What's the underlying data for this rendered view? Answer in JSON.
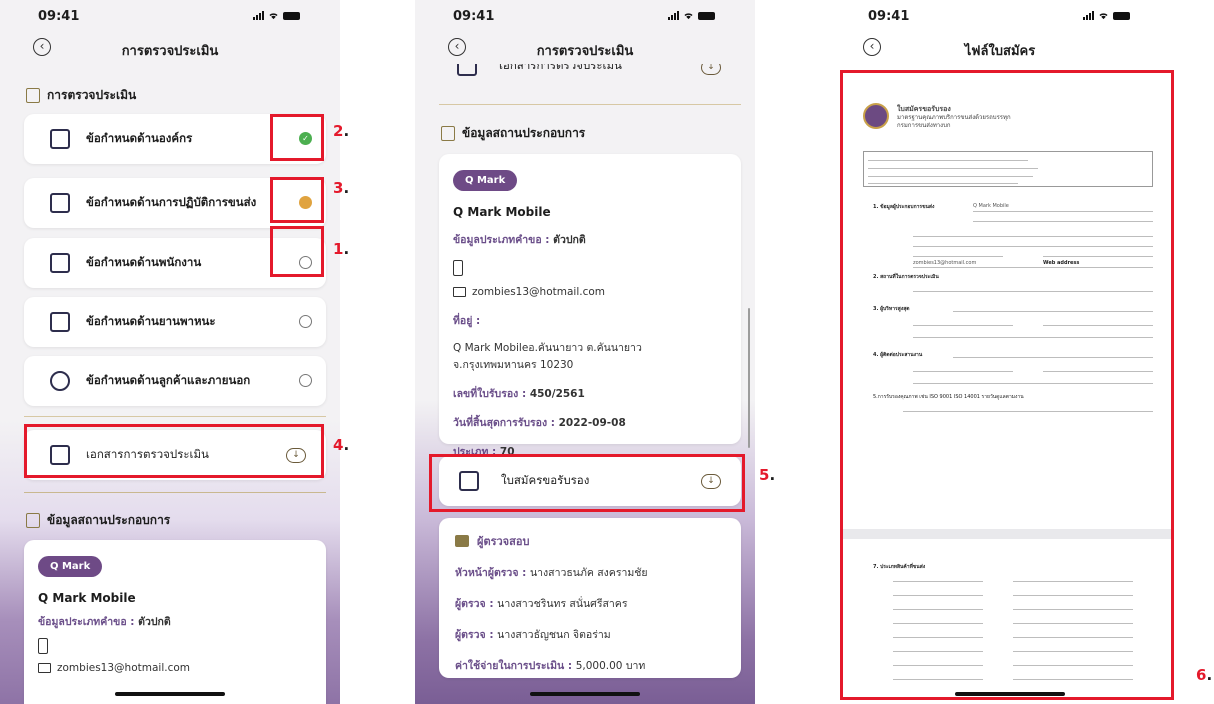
{
  "status": {
    "time": "09:41"
  },
  "screen1": {
    "nav_title": "การตรวจประเมิน",
    "section_title": "การตรวจประเมิน",
    "items": [
      {
        "label": "ข้อกำหนดด้านองค์กร",
        "status": "done",
        "icon": "building-icon"
      },
      {
        "label": "ข้อกำหนดด้านการปฏิบัติการขนส่ง",
        "status": "pending",
        "icon": "cube-icon"
      },
      {
        "label": "ข้อกำหนดด้านพนักงาน",
        "status": "empty",
        "icon": "document-edit-icon"
      },
      {
        "label": "ข้อกำหนดด้านยานพาหนะ",
        "status": "empty",
        "icon": "truck-icon"
      },
      {
        "label": "ข้อกำหนดด้านลูกค้าและภายนอก",
        "status": "empty",
        "icon": "user-circle-icon"
      }
    ],
    "doc_item": "เอกสารการตรวจประเมิน",
    "operator_section": "ข้อมูลสถานประกอบการ",
    "badge": "Q Mark",
    "company": "Q Mark Mobile",
    "type_label": "ข้อมูลประเภทคำขอ :",
    "type_value": "ตัวปกติ",
    "email": "zombies13@hotmail.com",
    "annotations": [
      "2",
      "3",
      "1",
      "4"
    ],
    "annotation_dot": "."
  },
  "screen2": {
    "nav_title": "การตรวจประเมิน",
    "partial_item": "เอกสารการตรวจประเมิน",
    "operator_section": "ข้อมูลสถานประกอบการ",
    "badge": "Q Mark",
    "company": "Q Mark Mobile",
    "type_label": "ข้อมูลประเภทคำขอ :",
    "type_value": "ตัวปกติ",
    "email": "zombies13@hotmail.com",
    "address_label": "ที่อยู่ :",
    "address_line1": "Q Mark Mobileอ.คันนายาว ต.คันนายาว",
    "address_line2": "จ.กรุงเทพมหานคร 10230",
    "cert_no_label": "เลขที่ใบรับรอง :",
    "cert_no": "450/2561",
    "expiry_label": "วันที่สิ้นสุดการรับรอง :",
    "expiry": "2022-09-08",
    "category_label": "ประเภท :",
    "category": "70",
    "application_item": "ใบสมัครขอรับรอง",
    "inspector_section": "ผู้ตรวจสอบ",
    "lead_label": "หัวหน้าผู้ตรวจ :",
    "lead": "นางสาวธนภัค สงครามชัย",
    "inspector1_label": "ผู้ตรวจ :",
    "inspector1": "นางสาวชรินทร สนั่นศรีสาคร",
    "inspector2_label": "ผู้ตรวจ :",
    "inspector2": "นางสาวธัญชนก จิตอร่าม",
    "cost_label": "ค่าใช้จ่ายในการประเมิน :",
    "cost": "5,000.00 บาท",
    "annotation": "5"
  },
  "screen3": {
    "nav_title": "ไฟล์ใบสมัคร",
    "doc_title": "ใบสมัครขอรับรอง",
    "doc_sub1": "มาตรฐานคุณภาพบริการขนส่งด้วยรถบรรทุก",
    "doc_sub2": "กรมการขนส่งทางบก",
    "doc_section1": "1. ข้อมูลผู้ประกอบการขนส่ง",
    "doc_name_hint": "Q Mark Mobile",
    "doc_email": "zombies13@hotmail.com",
    "doc_web": "Web address",
    "doc_section2": "2. สถานที่ในการตรวจประเมิน",
    "doc_section3": "3. ผู้บริหารสูงสุด",
    "doc_section4": "4. ผู้ติดต่อประสานงาน",
    "doc_section5": "5.การรับรองคุณภาพ เช่น ISO 9001 ISO 14001 รายวันดูแลตามงาน",
    "doc_section7": "7. ประเภทสินค้าที่ขนส่ง",
    "annotation": "6"
  }
}
